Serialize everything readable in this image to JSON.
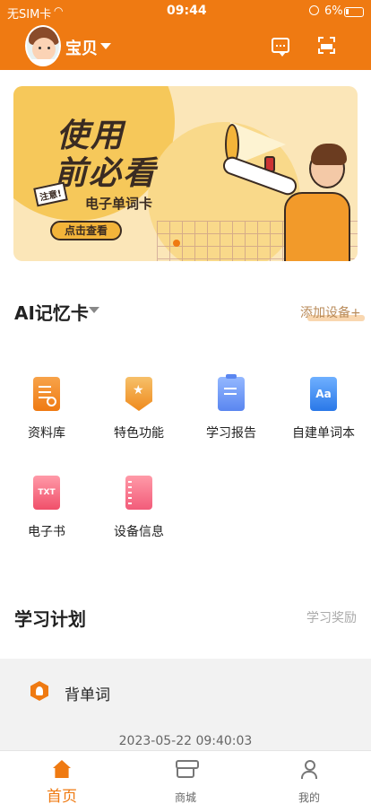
{
  "status_bar": {
    "carrier": "无SIM卡",
    "time": "09:44",
    "battery": "6%"
  },
  "header": {
    "profile_name": "宝贝",
    "icons": [
      "message-icon",
      "scan-icon"
    ]
  },
  "banner": {
    "title_line1": "使用",
    "title_line2": "前必看",
    "note_tag": "注意!",
    "subtitle": "电子单词卡",
    "button_label": "点击查看"
  },
  "ai_section": {
    "title": "AI记忆卡",
    "add_device": "添加设备+",
    "features": [
      {
        "label": "资料库",
        "icon": "library-icon"
      },
      {
        "label": "特色功能",
        "icon": "special-feature-icon"
      },
      {
        "label": "学习报告",
        "icon": "report-icon"
      },
      {
        "label": "自建单词本",
        "icon": "wordbook-icon",
        "icon_text": "Aa"
      },
      {
        "label": "电子书",
        "icon": "ebook-icon",
        "icon_text": "TXT"
      },
      {
        "label": "设备信息",
        "icon": "device-info-icon"
      }
    ]
  },
  "study_plan": {
    "title": "学习计划",
    "reward": "学习奖励",
    "item_label": "背单词",
    "timestamp": "2023-05-22 09:40:03"
  },
  "tabbar": {
    "tabs": [
      {
        "label": "首页",
        "active": true
      },
      {
        "label": "商城",
        "active": false
      },
      {
        "label": "我的",
        "active": false
      }
    ]
  },
  "colors": {
    "accent": "#ef7a12",
    "banner_bg": "#fbe6b8"
  }
}
